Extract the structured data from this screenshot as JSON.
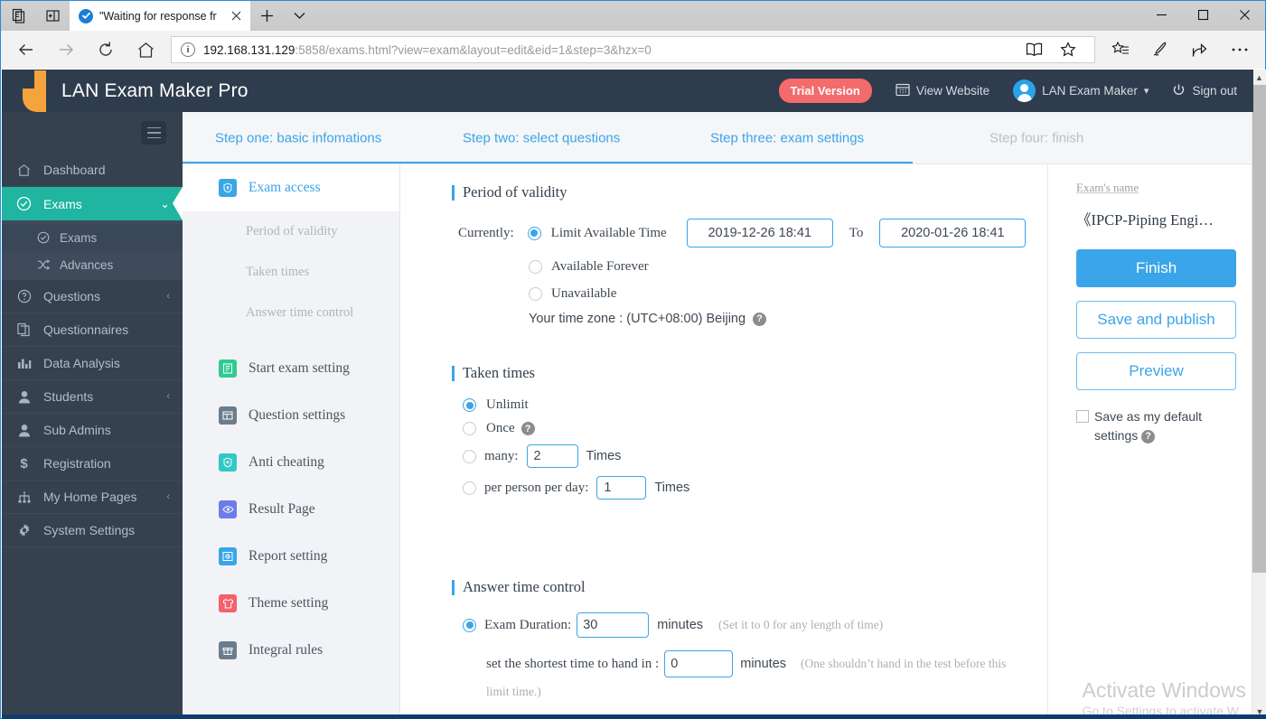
{
  "browser": {
    "tab_title": "\"Waiting for response fr",
    "tab_favicon": "check-circle-icon",
    "new_tab_label": "+",
    "url_host": "192.168.131.129",
    "url_rest": ":5858/exams.html?view=exam&layout=edit&eid=1&step=3&hzx=0",
    "window_minimize": "—",
    "window_maximize": "□",
    "window_close": "✕"
  },
  "header": {
    "brand": "LAN Exam Maker Pro",
    "trial_badge": "Trial Version",
    "view_website": "View Website",
    "user_name": "LAN Exam Maker",
    "sign_out": "Sign out"
  },
  "sidebar": {
    "items": [
      {
        "label": "Dashboard",
        "icon": "home-icon",
        "arrow": ""
      },
      {
        "label": "Exams",
        "icon": "check-circle-icon",
        "arrow": "⌄",
        "active": true
      },
      {
        "label": "Questions",
        "icon": "question-circle-icon",
        "arrow": "‹"
      },
      {
        "label": "Questionnaires",
        "icon": "documents-icon",
        "arrow": ""
      },
      {
        "label": "Data Analysis",
        "icon": "bar-chart-icon",
        "arrow": ""
      },
      {
        "label": "Students",
        "icon": "user-icon",
        "arrow": "‹"
      },
      {
        "label": "Sub Admins",
        "icon": "user-icon",
        "arrow": ""
      },
      {
        "label": "Registration",
        "icon": "dollar-icon",
        "arrow": ""
      },
      {
        "label": "My Home Pages",
        "icon": "sitemap-icon",
        "arrow": "‹"
      },
      {
        "label": "System Settings",
        "icon": "gear-icon",
        "arrow": ""
      }
    ],
    "subitems": [
      {
        "label": "Exams",
        "icon": "check-circle-icon",
        "active": true
      },
      {
        "label": "Advances",
        "icon": "shuffle-icon",
        "active": false
      }
    ]
  },
  "steps": [
    {
      "label": "Step one: basic infomations",
      "active": true
    },
    {
      "label": "Step two: select questions",
      "active": true
    },
    {
      "label": "Step three: exam settings",
      "active": true
    },
    {
      "label": "Step four: finish",
      "active": false
    }
  ],
  "settings_nav": [
    {
      "label": "Exam access",
      "icon": "shield-icon",
      "color": "#3aa5e8",
      "active": true
    },
    {
      "label": "Period of validity",
      "sub": true
    },
    {
      "label": "Taken times",
      "sub": true
    },
    {
      "label": "Answer time control",
      "sub": true
    },
    {
      "label": "Start exam setting",
      "icon": "list-icon",
      "color": "#2ecc8f"
    },
    {
      "label": "Question settings",
      "icon": "grid-icon",
      "color": "#6b7c8c"
    },
    {
      "label": "Anti cheating",
      "icon": "shield-icon",
      "color": "#31c9c4"
    },
    {
      "label": "Result Page",
      "icon": "eye-icon",
      "color": "#6d7de8"
    },
    {
      "label": "Report setting",
      "icon": "report-icon",
      "color": "#3aa5e8"
    },
    {
      "label": "Theme setting",
      "icon": "shirt-icon",
      "color": "#f4616a"
    },
    {
      "label": "Integral rules",
      "icon": "gift-icon",
      "color": "#6b7c8c"
    }
  ],
  "main": {
    "period": {
      "title": "Period of validity",
      "currently_label": "Currently:",
      "options": [
        {
          "label": "Limit Available Time",
          "selected": true
        },
        {
          "label": "Available Forever",
          "selected": false
        },
        {
          "label": "Unavailable",
          "selected": false
        }
      ],
      "date_from": "2019-12-26 18:41",
      "to_label": "To",
      "date_to": "2020-01-26 18:41",
      "timezone": "Your time zone : (UTC+08:00) Beijing",
      "timezone_help": "?"
    },
    "taken_times": {
      "title": "Taken times",
      "options": [
        {
          "label": "Unlimit",
          "selected": true
        },
        {
          "label": "Once",
          "selected": false,
          "help": "?"
        },
        {
          "label": "many:",
          "selected": false,
          "value": "2",
          "suffix": "Times"
        },
        {
          "label": "per person per day:",
          "selected": false,
          "value": "1",
          "suffix": "Times"
        }
      ]
    },
    "answer_time": {
      "title": "Answer time control",
      "duration_label": "Exam Duration:",
      "duration_value": "30",
      "duration_unit": "minutes",
      "duration_hint": "(Set it to 0 for any length of time)",
      "shortest_label": "set the shortest time to hand in :",
      "shortest_value": "0",
      "shortest_unit": "minutes",
      "shortest_hint": "(One shouldn’t hand in the test before this",
      "shortest_hint2": "limit time.)"
    }
  },
  "right_panel": {
    "name_label": "Exam's name",
    "exam_name": "《IPCP-Piping Engi…",
    "finish": "Finish",
    "save_and_publish": "Save and publish",
    "preview": "Preview",
    "default_settings_line1": "Save as my default",
    "default_settings_line2": "settings",
    "default_settings_help": "?"
  },
  "watermark": {
    "line1": "Activate Windows",
    "line2": "Go to Settings to activate W"
  },
  "colors": {
    "accent_blue": "#3aa5e8",
    "sidebar_dark": "#364150",
    "nav_active_green": "#1fb5a0",
    "trial_red": "#f46b6b",
    "brand_orange": "#f5a33c"
  }
}
